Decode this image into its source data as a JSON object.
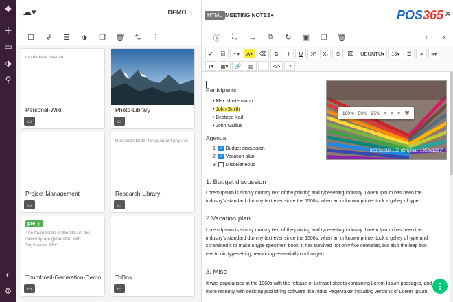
{
  "rail": {
    "icons": [
      "logo-icon",
      "plus-icon",
      "folder-icon",
      "tag-icon",
      "search-icon",
      "contrast-icon",
      "settings-icon"
    ]
  },
  "list": {
    "location": "DEMO",
    "cards": [
      {
        "title": "Personal-Wiki",
        "desc": "dasdadada dasdad",
        "kind": "text"
      },
      {
        "title": "Photo-Library",
        "desc": "",
        "kind": "photo"
      },
      {
        "title": "Project-Management",
        "desc": "",
        "kind": "text"
      },
      {
        "title": "Research-Library",
        "desc": "Research folder for quantum physics",
        "kind": "text"
      },
      {
        "title": "Thumbnail-Generation-Demo",
        "desc": "The thumbnails of the files in this directory are generated with TagSpaces PRO",
        "kind": "pro",
        "badge": "pro"
      },
      {
        "title": "ToDos",
        "desc": "",
        "kind": "text"
      }
    ]
  },
  "editor": {
    "badge": "HTML",
    "title": "MEETING NOTES",
    "logo_main": "POS",
    "logo_num": "365",
    "font_name": "UBUNTU",
    "font_size": "16",
    "participants_label": "Participants:",
    "participants": [
      "Max Mustermann",
      "John Smith",
      "Beatrice Karl",
      "John Gallius"
    ],
    "agenda_label": "Agenda:",
    "agenda": [
      {
        "num": "1.",
        "text": "Budget discussion",
        "checked": true
      },
      {
        "num": "2.",
        "text": "Vacation plan",
        "checked": true
      },
      {
        "num": "3.",
        "text": "Misceleneous",
        "checked": false
      }
    ],
    "image_tools": [
      "100%",
      "50%",
      "25%"
    ],
    "image_caption": "328.5x218.156 (Original: 1953x1297)",
    "sections": [
      {
        "heading": "1. Budget discussion",
        "text": "Lorem Ipsum is simply dummy text of the printing and typesetting industry. Lorem Ipsum has been the industry's standard dummy text ever since the 1500s, when an unknown printer took a galley of type ."
      },
      {
        "heading": "2.Vacation plan",
        "text": "Lorem Ipsum is simply dummy text of the printing and typesetting industry.  Lorem Ipsum has been the industry's standard dummy text ever since the 1500s, when an unknown printer took a galley of type and scrambled it to make a type specimen book. It has survived not only five centuries, but also the leap into electronic typesetting, remaining essentially unchanged."
      },
      {
        "heading": "3. Misc",
        "text": "It was popularised in the 1960s with the release of Letraset sheets containing Lorem Ipsum passages, and more recently with desktop publishing software like Aldus PageMaker including versions of Lorem Ipsum."
      }
    ]
  }
}
